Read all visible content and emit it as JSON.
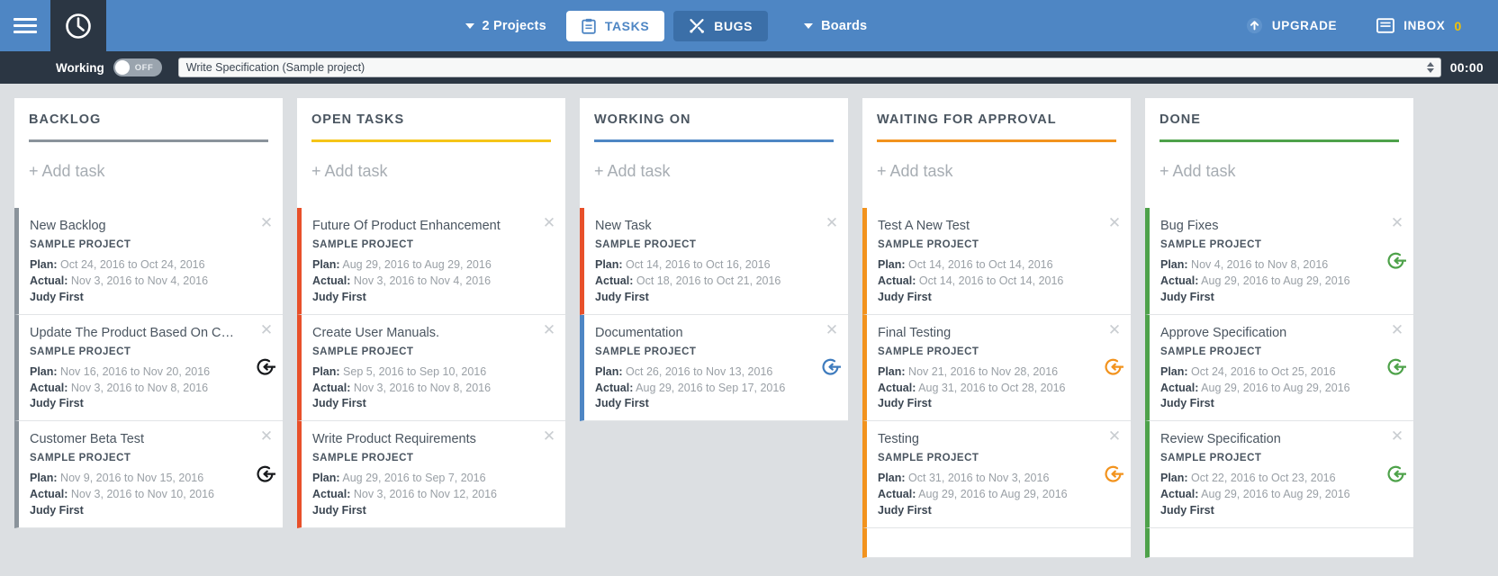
{
  "nav": {
    "hamburger": "menu-icon",
    "logo": "clock-icon",
    "projects_label": "2 Projects",
    "tasks_label": "TASKS",
    "bugs_label": "BUGS",
    "boards_label": "Boards",
    "upgrade_label": "UPGRADE",
    "inbox_label": "INBOX",
    "inbox_count": "0",
    "colors": {
      "bar": "#4e86c4",
      "active_tab_bg": "#3b6fa8",
      "inbox_count": "#f2c200"
    }
  },
  "timerbar": {
    "working_label": "Working",
    "toggle_state": "OFF",
    "selected_task": "Write Specification (Sample project)",
    "timer": "00:00",
    "bg": "#2b3643"
  },
  "board": {
    "add_task_label": "+ Add task",
    "columns": [
      {
        "title": "BACKLOG",
        "rule_color": "#8a939b",
        "cards": [
          {
            "title": "New Backlog",
            "project": "SAMPLE PROJECT",
            "plan_label": "Plan:",
            "plan": "Oct 24, 2016 to Oct 24, 2016",
            "actual_label": "Actual:",
            "actual": "Nov 3, 2016 to Nov 4, 2016",
            "owner": "Judy First",
            "accent": "#8a939b",
            "action": null
          },
          {
            "title": "Update The Product Based On Custo…",
            "project": "SAMPLE PROJECT",
            "plan_label": "Plan:",
            "plan": "Nov 16, 2016 to Nov 20, 2016",
            "actual_label": "Actual:",
            "actual": "Nov 3, 2016 to Nov 8, 2016",
            "owner": "Judy First",
            "accent": "#8a939b",
            "action": "#17191c"
          },
          {
            "title": "Customer Beta Test",
            "project": "SAMPLE PROJECT",
            "plan_label": "Plan:",
            "plan": "Nov 9, 2016 to Nov 15, 2016",
            "actual_label": "Actual:",
            "actual": "Nov 3, 2016 to Nov 10, 2016",
            "owner": "Judy First",
            "accent": "#8a939b",
            "action": "#17191c"
          }
        ]
      },
      {
        "title": "OPEN TASKS",
        "rule_color": "#f5c518",
        "cards": [
          {
            "title": "Future Of Product Enhancement",
            "project": "SAMPLE PROJECT",
            "plan_label": "Plan:",
            "plan": "Aug 29, 2016 to Aug 29, 2016",
            "actual_label": "Actual:",
            "actual": "Nov 3, 2016 to Nov 4, 2016",
            "owner": "Judy First",
            "accent": "#e8502a",
            "action": null
          },
          {
            "title": "Create User Manuals.",
            "project": "SAMPLE PROJECT",
            "plan_label": "Plan:",
            "plan": "Sep 5, 2016 to Sep 10, 2016",
            "actual_label": "Actual:",
            "actual": "Nov 3, 2016 to Nov 8, 2016",
            "owner": "Judy First",
            "accent": "#e8502a",
            "action": null
          },
          {
            "title": "Write Product Requirements",
            "project": "SAMPLE PROJECT",
            "plan_label": "Plan:",
            "plan": "Aug 29, 2016 to Sep 7, 2016",
            "actual_label": "Actual:",
            "actual": "Nov 3, 2016 to Nov 12, 2016",
            "owner": "Judy First",
            "accent": "#e8502a",
            "action": null
          }
        ]
      },
      {
        "title": "WORKING ON",
        "rule_color": "#4e86c4",
        "cards": [
          {
            "title": "New Task",
            "project": "SAMPLE PROJECT",
            "plan_label": "Plan:",
            "plan": "Oct 14, 2016 to Oct 16, 2016",
            "actual_label": "Actual:",
            "actual": "Oct 18, 2016 to Oct 21, 2016",
            "owner": "Judy First",
            "accent": "#e8502a",
            "action": null
          },
          {
            "title": "Documentation",
            "project": "SAMPLE PROJECT",
            "plan_label": "Plan:",
            "plan": "Oct 26, 2016 to Nov 13, 2016",
            "actual_label": "Actual:",
            "actual": "Aug 29, 2016 to Sep 17, 2016",
            "owner": "Judy First",
            "accent": "#4e86c4",
            "action": "#3f7cbe"
          }
        ]
      },
      {
        "title": "WAITING FOR APPROVAL",
        "rule_color": "#f2931e",
        "cards": [
          {
            "title": "Test A New Test",
            "project": "SAMPLE PROJECT",
            "plan_label": "Plan:",
            "plan": "Oct 14, 2016 to Oct 14, 2016",
            "actual_label": "Actual:",
            "actual": "Oct 14, 2016 to Oct 14, 2016",
            "owner": "Judy First",
            "accent": "#f2931e",
            "action": null
          },
          {
            "title": "Final Testing",
            "project": "SAMPLE PROJECT",
            "plan_label": "Plan:",
            "plan": "Nov 21, 2016 to Nov 28, 2016",
            "actual_label": "Actual:",
            "actual": "Aug 31, 2016 to Oct 28, 2016",
            "owner": "Judy First",
            "accent": "#f2931e",
            "action": "#f2931e"
          },
          {
            "title": "Testing",
            "project": "SAMPLE PROJECT",
            "plan_label": "Plan:",
            "plan": "Oct 31, 2016 to Nov 3, 2016",
            "actual_label": "Actual:",
            "actual": "Aug 29, 2016 to Aug 29, 2016",
            "owner": "Judy First",
            "accent": "#f2931e",
            "action": "#f2931e"
          },
          {
            "title": "",
            "project": "",
            "plan_label": "",
            "plan": "",
            "actual_label": "",
            "actual": "",
            "owner": "",
            "accent": "#f2931e",
            "action": null
          }
        ]
      },
      {
        "title": "DONE",
        "rule_color": "#4ea24a",
        "cards": [
          {
            "title": "Bug Fixes",
            "project": "SAMPLE PROJECT",
            "plan_label": "Plan:",
            "plan": "Nov 4, 2016 to Nov 8, 2016",
            "actual_label": "Actual:",
            "actual": "Aug 29, 2016 to Aug 29, 2016",
            "owner": "Judy First",
            "accent": "#4ea24a",
            "action": "#4ea24a"
          },
          {
            "title": "Approve Specification",
            "project": "SAMPLE PROJECT",
            "plan_label": "Plan:",
            "plan": "Oct 24, 2016 to Oct 25, 2016",
            "actual_label": "Actual:",
            "actual": "Aug 29, 2016 to Aug 29, 2016",
            "owner": "Judy First",
            "accent": "#4ea24a",
            "action": "#4ea24a"
          },
          {
            "title": "Review Specification",
            "project": "SAMPLE PROJECT",
            "plan_label": "Plan:",
            "plan": "Oct 22, 2016 to Oct 23, 2016",
            "actual_label": "Actual:",
            "actual": "Aug 29, 2016 to Aug 29, 2016",
            "owner": "Judy First",
            "accent": "#4ea24a",
            "action": "#4ea24a"
          },
          {
            "title": "",
            "project": "",
            "plan_label": "",
            "plan": "",
            "actual_label": "",
            "actual": "",
            "owner": "",
            "accent": "#4ea24a",
            "action": null
          }
        ]
      }
    ]
  }
}
